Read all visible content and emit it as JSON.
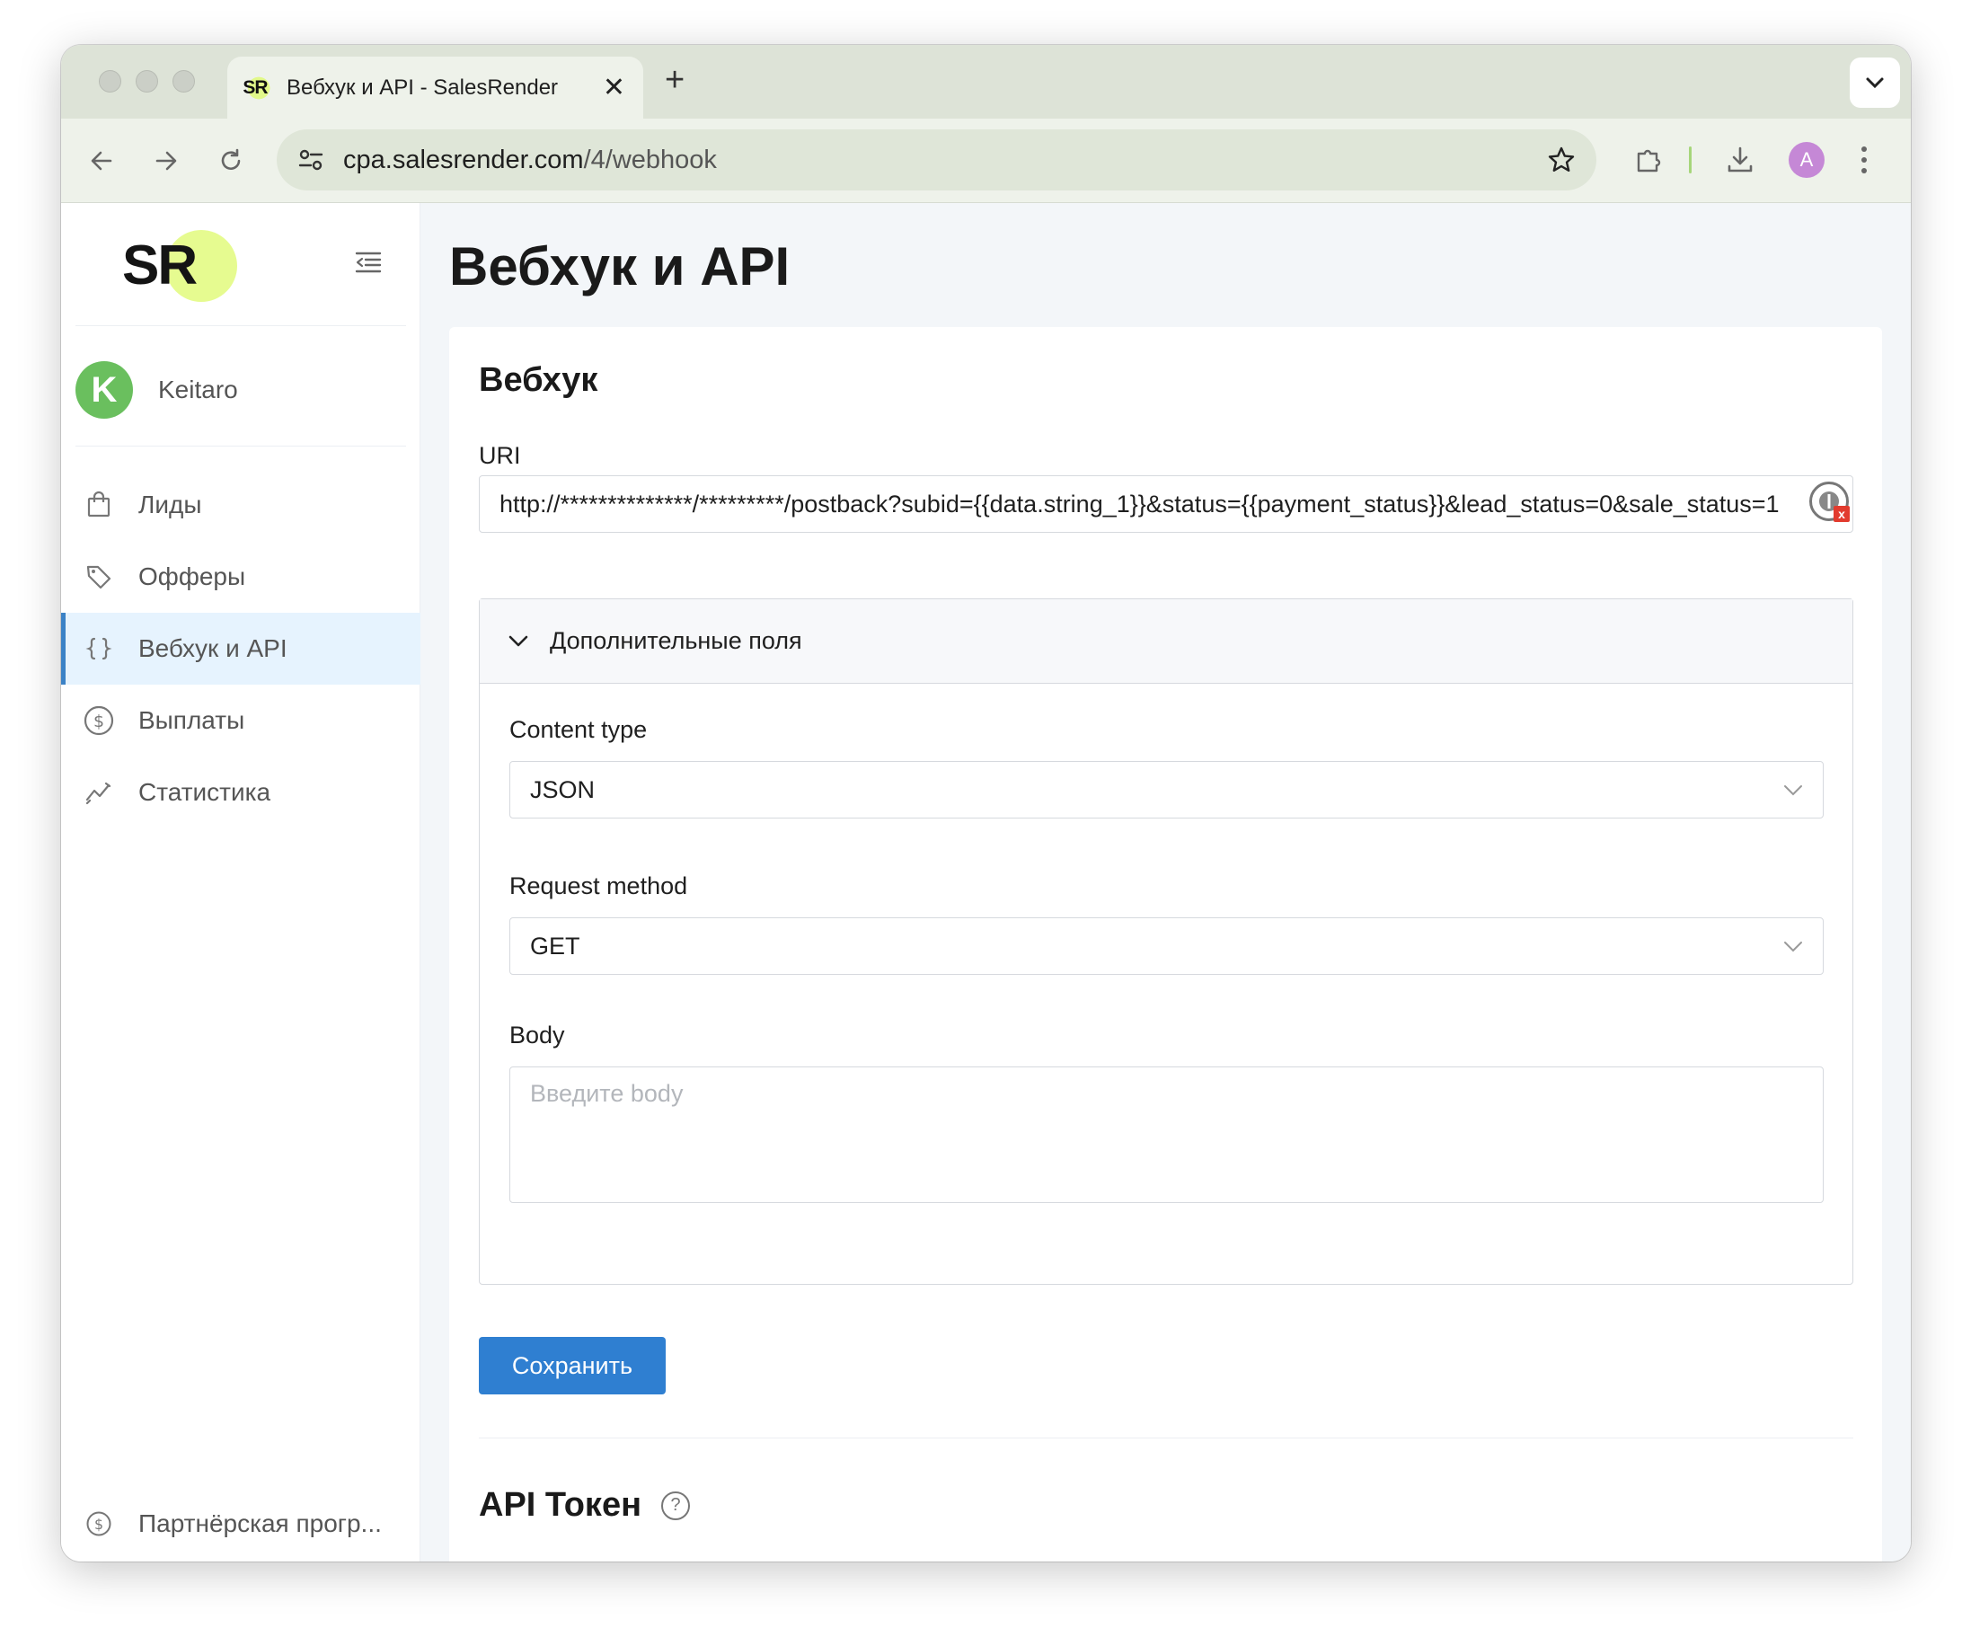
{
  "browser": {
    "tab_title": "Вебхук и API - SalesRender",
    "favicon_text": "SR",
    "url_host": "cpa.salesrender.com",
    "url_path": "/4/webhook",
    "profile_initial": "A"
  },
  "sidebar": {
    "logo_text": "SR",
    "user_initial": "K",
    "user_name": "Keitaro",
    "items": [
      {
        "label": "Лиды",
        "icon": "bag-icon"
      },
      {
        "label": "Офферы",
        "icon": "tag-icon"
      },
      {
        "label": "Вебхук и API",
        "icon": "braces-icon",
        "active": true
      },
      {
        "label": "Выплаты",
        "icon": "dollar-icon"
      },
      {
        "label": "Статистика",
        "icon": "chart-icon"
      }
    ],
    "partner_label": "Партнёрская прогр..."
  },
  "page": {
    "title": "Вебхук и API",
    "webhook_title": "Вебхук",
    "uri_label": "URI",
    "uri_value": "http://**************/*********/postback?subid={{data.string_1}}&status={{payment_status}}&lead_status=0&sale_status=1",
    "extra_fields_label": "Дополнительные поля",
    "content_type_label": "Content type",
    "content_type_value": "JSON",
    "request_method_label": "Request method",
    "request_method_value": "GET",
    "body_label": "Body",
    "body_placeholder": "Введите body",
    "save_label": "Сохранить",
    "api_title": "API Токен"
  },
  "colors": {
    "accent": "#2f7fd1",
    "logo_accent": "#e6fb90",
    "active_bg": "#e6f3fe",
    "user_avatar": "#6abf5e"
  }
}
